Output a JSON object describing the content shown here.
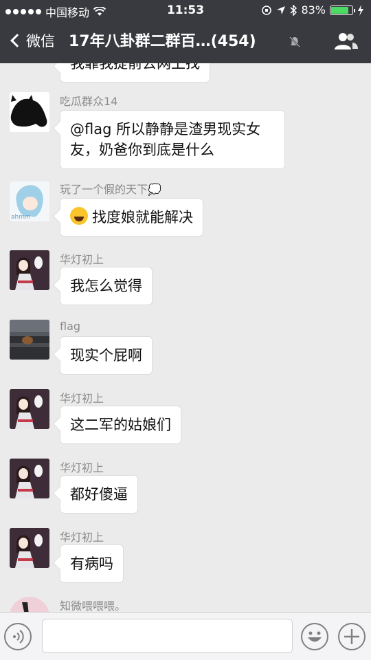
{
  "status_bar": {
    "carrier": "中国移动",
    "time": "11:53",
    "battery": "83%",
    "battery_level": 0.83
  },
  "nav": {
    "back_label": "微信",
    "title": "17年八卦群二群百…(454)"
  },
  "messages": [
    {
      "sender": "",
      "text": "我靠我提前去网上找",
      "partial": true
    },
    {
      "sender": "吃瓜群众14",
      "text": "@flag 所以静静是渣男现实女友，奶爸你到底是什么"
    },
    {
      "sender": "玩了一个假的天下💭",
      "text": "找度娘就能解决",
      "emoji": "tears-of-joy"
    },
    {
      "sender": "华灯初上",
      "text": "我怎么觉得"
    },
    {
      "sender": "flag",
      "text": "现实个屁啊"
    },
    {
      "sender": "华灯初上",
      "text": "这二军的姑娘们"
    },
    {
      "sender": "华灯初上",
      "text": "都好傻逼"
    },
    {
      "sender": "华灯初上",
      "text": "有病吗"
    },
    {
      "sender": "知微喂喂喂。",
      "text": ""
    }
  ],
  "colors": {
    "nav_bg": "#393a3f",
    "chat_bg": "#ebebeb",
    "battery": "#4cd964"
  }
}
